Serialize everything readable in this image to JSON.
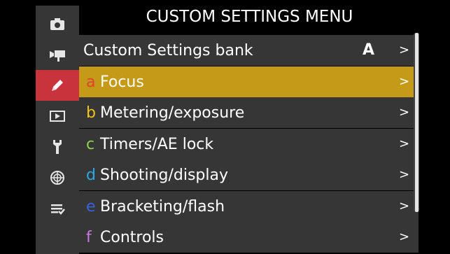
{
  "title": "CUSTOM SETTINGS MENU",
  "sidebar": {
    "items": [
      {
        "icon": "camera-icon"
      },
      {
        "icon": "movie-camera-icon"
      },
      {
        "icon": "pencil-icon",
        "active": true
      },
      {
        "icon": "playback-icon"
      },
      {
        "icon": "wrench-icon"
      },
      {
        "icon": "network-icon"
      },
      {
        "icon": "my-menu-icon"
      }
    ]
  },
  "menu": {
    "rows": [
      {
        "letter": "",
        "label": "Custom Settings bank",
        "value": "A",
        "chevron": ">"
      },
      {
        "letter": "a",
        "label": "Focus",
        "chevron": ">",
        "selected": true,
        "letter_color": "#e0402f"
      },
      {
        "letter": "b",
        "label": "Metering/exposure",
        "chevron": ">",
        "letter_color": "#f2c21a"
      },
      {
        "letter": "c",
        "label": "Timers/AE lock",
        "chevron": ">",
        "letter_color": "#8fd14f"
      },
      {
        "letter": "d",
        "label": "Shooting/display",
        "chevron": ">",
        "letter_color": "#2aa8e8"
      },
      {
        "letter": "e",
        "label": "Bracketing/flash",
        "chevron": ">",
        "letter_color": "#3a63e0"
      },
      {
        "letter": "f",
        "label": "Controls",
        "chevron": ">",
        "letter_color": "#c77be0"
      }
    ]
  },
  "colors": {
    "sidebar_bg": "#363636",
    "row_bg": "#363636",
    "selected_row": "#c49a18",
    "active_tab": "#c9333b"
  }
}
